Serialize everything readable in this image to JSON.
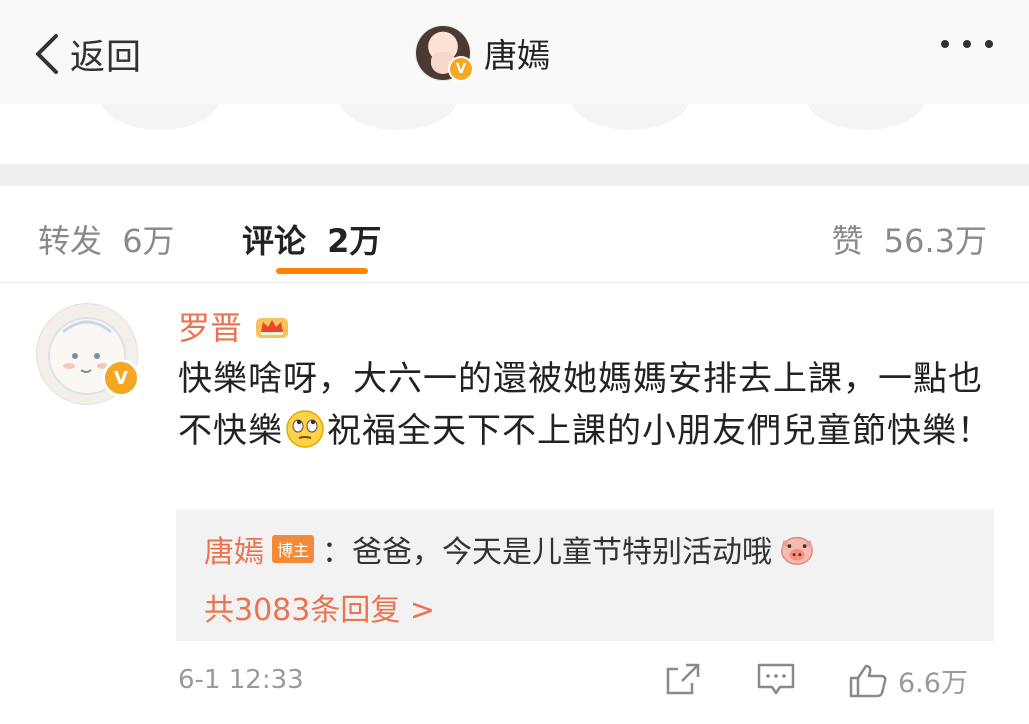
{
  "header": {
    "back_label": "返回",
    "title": "唐嫣"
  },
  "tabs": [
    {
      "label": "转发",
      "count": "6万"
    },
    {
      "label": "评论",
      "count": "2万"
    },
    {
      "label": "赞",
      "count": "56.3万"
    }
  ],
  "comment": {
    "author": "罗晋",
    "text_before_emoji": "快樂啥呀，大六一的還被她媽媽安排去上課，一點也不快樂",
    "emoji_name": "eye-roll-emoji",
    "text_after_emoji": "祝福全天下不上課的小朋友們兒童節快樂！",
    "reply": {
      "author": "唐嫣",
      "badge": "博主",
      "text": "：爸爸，今天是儿童节特别活动哦",
      "emoji_name": "pig-emoji"
    },
    "more_replies": "共3083条回复 >",
    "time": "6-1 12:33",
    "like_count": "6.6万"
  },
  "colors": {
    "accent": "#ff8200",
    "name_color": "#eb7350",
    "verified": "#f5a623"
  }
}
